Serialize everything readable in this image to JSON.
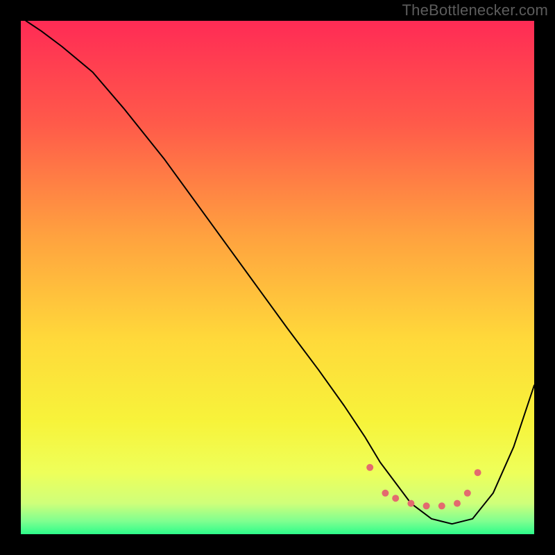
{
  "watermark": "TheBottlenecker.com",
  "chart_data": {
    "type": "line",
    "title": "",
    "xlabel": "",
    "ylabel": "",
    "xlim": [
      0,
      100
    ],
    "ylim": [
      0,
      100
    ],
    "grid": false,
    "background_gradient_stops": [
      {
        "offset": 0.0,
        "color": "#ff2b55"
      },
      {
        "offset": 0.2,
        "color": "#ff5a4a"
      },
      {
        "offset": 0.42,
        "color": "#ffa23f"
      },
      {
        "offset": 0.62,
        "color": "#ffd93a"
      },
      {
        "offset": 0.78,
        "color": "#f7f33a"
      },
      {
        "offset": 0.88,
        "color": "#eeff5a"
      },
      {
        "offset": 0.94,
        "color": "#cfff7a"
      },
      {
        "offset": 0.975,
        "color": "#7eff90"
      },
      {
        "offset": 1.0,
        "color": "#2dfc8a"
      }
    ],
    "series": [
      {
        "name": "curve",
        "color": "#000000",
        "stroke_width": 2,
        "x": [
          1,
          4,
          8,
          14,
          20,
          28,
          36,
          44,
          52,
          58,
          63,
          67,
          70,
          73,
          76,
          80,
          84,
          88,
          92,
          96,
          100
        ],
        "y": [
          100,
          98,
          95,
          90,
          83,
          73,
          62,
          51,
          40,
          32,
          25,
          19,
          14,
          10,
          6,
          3,
          2,
          3,
          8,
          17,
          29
        ]
      }
    ],
    "markers": {
      "name": "dots",
      "color": "#e36a6f",
      "radius": 5,
      "x": [
        68,
        71,
        73,
        76,
        79,
        82,
        85,
        87,
        89
      ],
      "y": [
        13,
        8,
        7,
        6,
        5.5,
        5.5,
        6,
        8,
        12
      ]
    }
  }
}
